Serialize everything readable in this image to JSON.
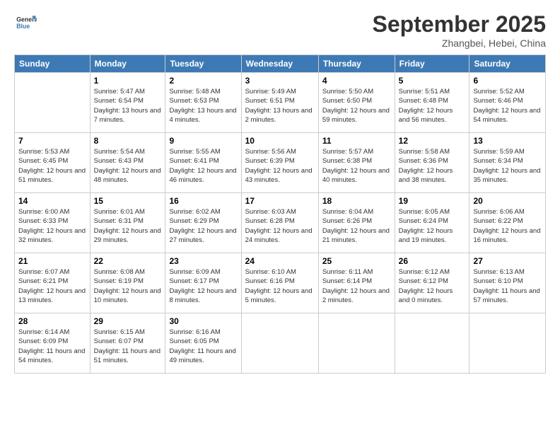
{
  "logo": {
    "line1": "General",
    "line2": "Blue"
  },
  "title": "September 2025",
  "location": "Zhangbei, Hebei, China",
  "days_of_week": [
    "Sunday",
    "Monday",
    "Tuesday",
    "Wednesday",
    "Thursday",
    "Friday",
    "Saturday"
  ],
  "weeks": [
    [
      {
        "day": "",
        "sunrise": "",
        "sunset": "",
        "daylight": ""
      },
      {
        "day": "1",
        "sunrise": "Sunrise: 5:47 AM",
        "sunset": "Sunset: 6:54 PM",
        "daylight": "Daylight: 13 hours and 7 minutes."
      },
      {
        "day": "2",
        "sunrise": "Sunrise: 5:48 AM",
        "sunset": "Sunset: 6:53 PM",
        "daylight": "Daylight: 13 hours and 4 minutes."
      },
      {
        "day": "3",
        "sunrise": "Sunrise: 5:49 AM",
        "sunset": "Sunset: 6:51 PM",
        "daylight": "Daylight: 13 hours and 2 minutes."
      },
      {
        "day": "4",
        "sunrise": "Sunrise: 5:50 AM",
        "sunset": "Sunset: 6:50 PM",
        "daylight": "Daylight: 12 hours and 59 minutes."
      },
      {
        "day": "5",
        "sunrise": "Sunrise: 5:51 AM",
        "sunset": "Sunset: 6:48 PM",
        "daylight": "Daylight: 12 hours and 56 minutes."
      },
      {
        "day": "6",
        "sunrise": "Sunrise: 5:52 AM",
        "sunset": "Sunset: 6:46 PM",
        "daylight": "Daylight: 12 hours and 54 minutes."
      }
    ],
    [
      {
        "day": "7",
        "sunrise": "Sunrise: 5:53 AM",
        "sunset": "Sunset: 6:45 PM",
        "daylight": "Daylight: 12 hours and 51 minutes."
      },
      {
        "day": "8",
        "sunrise": "Sunrise: 5:54 AM",
        "sunset": "Sunset: 6:43 PM",
        "daylight": "Daylight: 12 hours and 48 minutes."
      },
      {
        "day": "9",
        "sunrise": "Sunrise: 5:55 AM",
        "sunset": "Sunset: 6:41 PM",
        "daylight": "Daylight: 12 hours and 46 minutes."
      },
      {
        "day": "10",
        "sunrise": "Sunrise: 5:56 AM",
        "sunset": "Sunset: 6:39 PM",
        "daylight": "Daylight: 12 hours and 43 minutes."
      },
      {
        "day": "11",
        "sunrise": "Sunrise: 5:57 AM",
        "sunset": "Sunset: 6:38 PM",
        "daylight": "Daylight: 12 hours and 40 minutes."
      },
      {
        "day": "12",
        "sunrise": "Sunrise: 5:58 AM",
        "sunset": "Sunset: 6:36 PM",
        "daylight": "Daylight: 12 hours and 38 minutes."
      },
      {
        "day": "13",
        "sunrise": "Sunrise: 5:59 AM",
        "sunset": "Sunset: 6:34 PM",
        "daylight": "Daylight: 12 hours and 35 minutes."
      }
    ],
    [
      {
        "day": "14",
        "sunrise": "Sunrise: 6:00 AM",
        "sunset": "Sunset: 6:33 PM",
        "daylight": "Daylight: 12 hours and 32 minutes."
      },
      {
        "day": "15",
        "sunrise": "Sunrise: 6:01 AM",
        "sunset": "Sunset: 6:31 PM",
        "daylight": "Daylight: 12 hours and 29 minutes."
      },
      {
        "day": "16",
        "sunrise": "Sunrise: 6:02 AM",
        "sunset": "Sunset: 6:29 PM",
        "daylight": "Daylight: 12 hours and 27 minutes."
      },
      {
        "day": "17",
        "sunrise": "Sunrise: 6:03 AM",
        "sunset": "Sunset: 6:28 PM",
        "daylight": "Daylight: 12 hours and 24 minutes."
      },
      {
        "day": "18",
        "sunrise": "Sunrise: 6:04 AM",
        "sunset": "Sunset: 6:26 PM",
        "daylight": "Daylight: 12 hours and 21 minutes."
      },
      {
        "day": "19",
        "sunrise": "Sunrise: 6:05 AM",
        "sunset": "Sunset: 6:24 PM",
        "daylight": "Daylight: 12 hours and 19 minutes."
      },
      {
        "day": "20",
        "sunrise": "Sunrise: 6:06 AM",
        "sunset": "Sunset: 6:22 PM",
        "daylight": "Daylight: 12 hours and 16 minutes."
      }
    ],
    [
      {
        "day": "21",
        "sunrise": "Sunrise: 6:07 AM",
        "sunset": "Sunset: 6:21 PM",
        "daylight": "Daylight: 12 hours and 13 minutes."
      },
      {
        "day": "22",
        "sunrise": "Sunrise: 6:08 AM",
        "sunset": "Sunset: 6:19 PM",
        "daylight": "Daylight: 12 hours and 10 minutes."
      },
      {
        "day": "23",
        "sunrise": "Sunrise: 6:09 AM",
        "sunset": "Sunset: 6:17 PM",
        "daylight": "Daylight: 12 hours and 8 minutes."
      },
      {
        "day": "24",
        "sunrise": "Sunrise: 6:10 AM",
        "sunset": "Sunset: 6:16 PM",
        "daylight": "Daylight: 12 hours and 5 minutes."
      },
      {
        "day": "25",
        "sunrise": "Sunrise: 6:11 AM",
        "sunset": "Sunset: 6:14 PM",
        "daylight": "Daylight: 12 hours and 2 minutes."
      },
      {
        "day": "26",
        "sunrise": "Sunrise: 6:12 AM",
        "sunset": "Sunset: 6:12 PM",
        "daylight": "Daylight: 12 hours and 0 minutes."
      },
      {
        "day": "27",
        "sunrise": "Sunrise: 6:13 AM",
        "sunset": "Sunset: 6:10 PM",
        "daylight": "Daylight: 11 hours and 57 minutes."
      }
    ],
    [
      {
        "day": "28",
        "sunrise": "Sunrise: 6:14 AM",
        "sunset": "Sunset: 6:09 PM",
        "daylight": "Daylight: 11 hours and 54 minutes."
      },
      {
        "day": "29",
        "sunrise": "Sunrise: 6:15 AM",
        "sunset": "Sunset: 6:07 PM",
        "daylight": "Daylight: 11 hours and 51 minutes."
      },
      {
        "day": "30",
        "sunrise": "Sunrise: 6:16 AM",
        "sunset": "Sunset: 6:05 PM",
        "daylight": "Daylight: 11 hours and 49 minutes."
      },
      {
        "day": "",
        "sunrise": "",
        "sunset": "",
        "daylight": ""
      },
      {
        "day": "",
        "sunrise": "",
        "sunset": "",
        "daylight": ""
      },
      {
        "day": "",
        "sunrise": "",
        "sunset": "",
        "daylight": ""
      },
      {
        "day": "",
        "sunrise": "",
        "sunset": "",
        "daylight": ""
      }
    ]
  ]
}
